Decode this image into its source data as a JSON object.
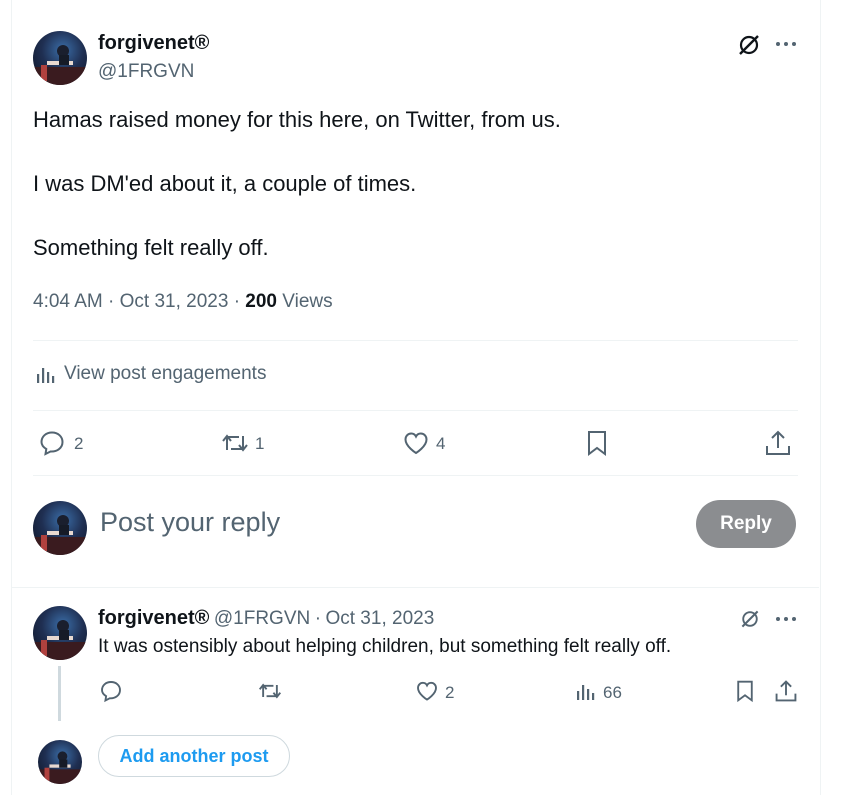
{
  "main_post": {
    "display_name": "forgivenet®",
    "handle": "@1FRGVN",
    "lines": [
      "Hamas raised money for this here, on Twitter, from us.",
      "I was DM'ed about it, a couple of times.",
      "Something felt really off."
    ],
    "time": "4:04 AM",
    "date": "Oct 31, 2023",
    "views_count": "200",
    "views_label": "Views",
    "engagements_label": "View post engagements",
    "replies": "2",
    "reposts": "1",
    "likes": "4"
  },
  "composer": {
    "placeholder": "Post your reply",
    "reply_button": "Reply"
  },
  "reply_post": {
    "display_name": "forgivenet®",
    "handle": "@1FRGVN",
    "date": "Oct 31, 2023",
    "text": "It was ostensibly about helping children, but something felt really off.",
    "likes": "2",
    "views": "66"
  },
  "add_post_label": "Add another post",
  "colors": {
    "accent": "#1d9bf0",
    "muted": "#536471",
    "reply_disabled": "#8b8d90"
  },
  "icons": [
    "grok-icon",
    "more-icon",
    "analytics-icon",
    "reply-icon",
    "repost-icon",
    "like-icon",
    "bookmark-icon",
    "share-icon"
  ]
}
